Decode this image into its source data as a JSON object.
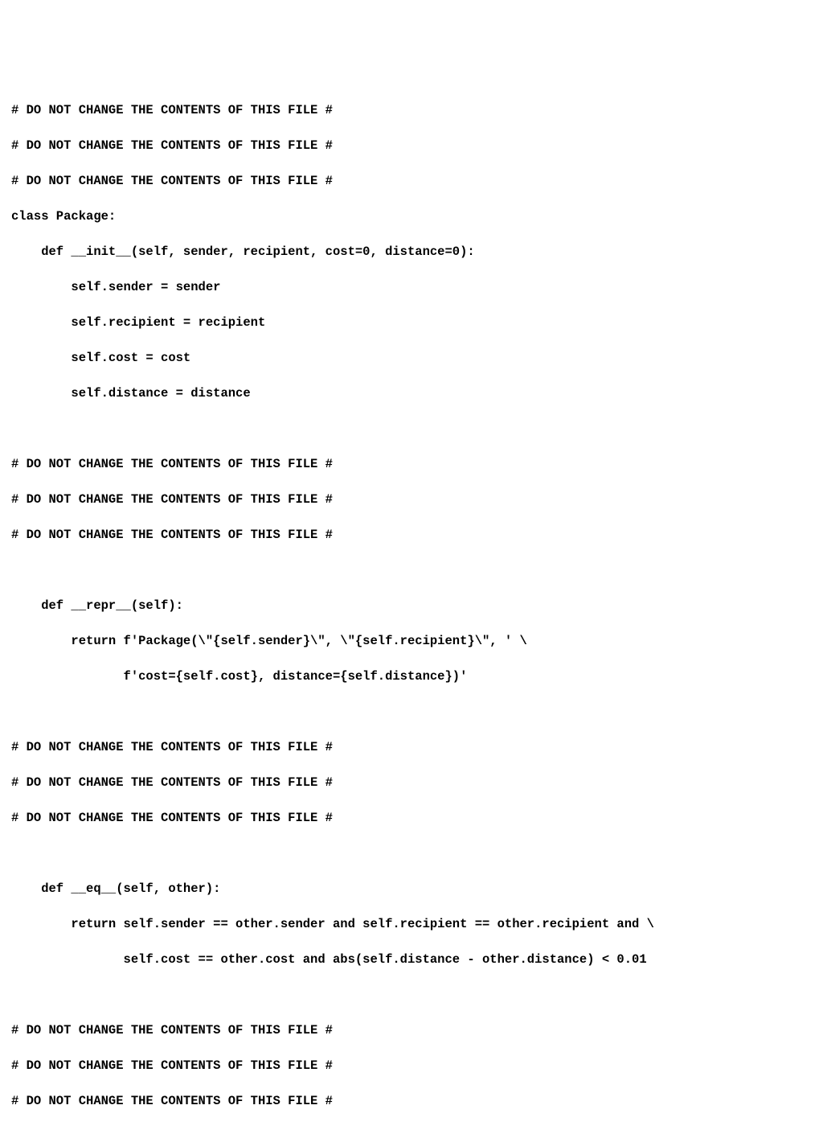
{
  "code": {
    "lines": [
      "# DO NOT CHANGE THE CONTENTS OF THIS FILE #",
      "# DO NOT CHANGE THE CONTENTS OF THIS FILE #",
      "# DO NOT CHANGE THE CONTENTS OF THIS FILE #",
      "class Package:",
      "    def __init__(self, sender, recipient, cost=0, distance=0):",
      "        self.sender = sender",
      "        self.recipient = recipient",
      "        self.cost = cost",
      "        self.distance = distance",
      "",
      "# DO NOT CHANGE THE CONTENTS OF THIS FILE #",
      "# DO NOT CHANGE THE CONTENTS OF THIS FILE #",
      "# DO NOT CHANGE THE CONTENTS OF THIS FILE #",
      "",
      "    def __repr__(self):",
      "        return f'Package(\\\"{self.sender}\\\", \\\"{self.recipient}\\\", ' \\",
      "               f'cost={self.cost}, distance={self.distance})'",
      "",
      "# DO NOT CHANGE THE CONTENTS OF THIS FILE #",
      "# DO NOT CHANGE THE CONTENTS OF THIS FILE #",
      "# DO NOT CHANGE THE CONTENTS OF THIS FILE #",
      "",
      "    def __eq__(self, other):",
      "        return self.sender == other.sender and self.recipient == other.recipient and \\",
      "               self.cost == other.cost and abs(self.distance - other.distance) < 0.01",
      "",
      "# DO NOT CHANGE THE CONTENTS OF THIS FILE #",
      "# DO NOT CHANGE THE CONTENTS OF THIS FILE #",
      "# DO NOT CHANGE THE CONTENTS OF THIS FILE #"
    ]
  }
}
